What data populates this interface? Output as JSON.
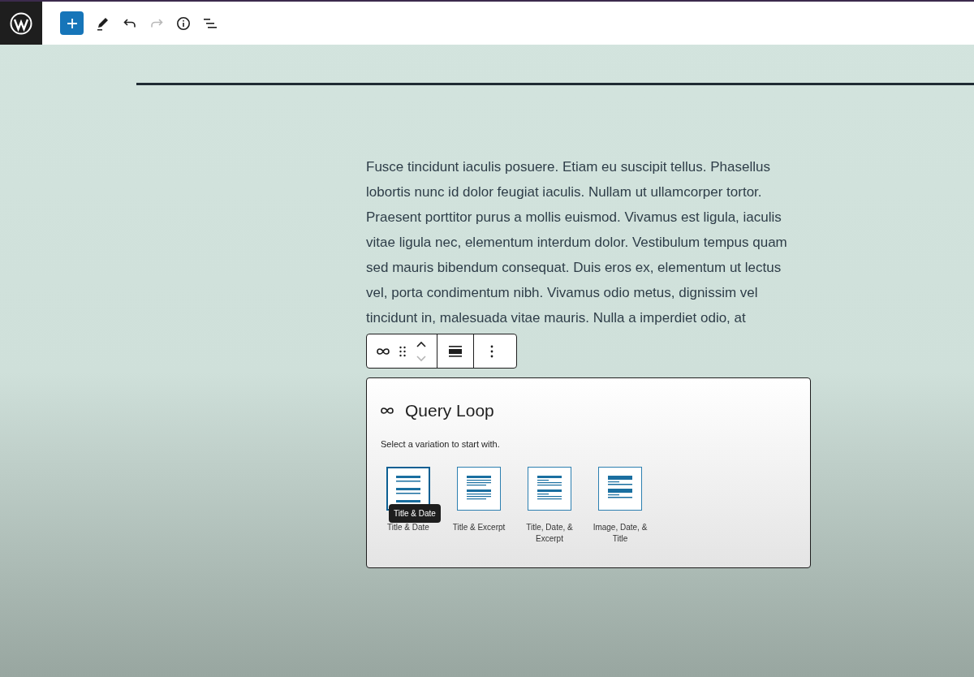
{
  "toolbar": [
    {
      "kind": "add",
      "disabled": false
    },
    {
      "kind": "edit",
      "disabled": false
    },
    {
      "kind": "undo",
      "disabled": false
    },
    {
      "kind": "redo",
      "disabled": true
    },
    {
      "kind": "info",
      "disabled": false
    },
    {
      "kind": "outline",
      "disabled": false
    }
  ],
  "paragraph": "Fusce tincidunt iaculis posuere. Etiam eu suscipit tellus. Phasellus lobortis nunc id dolor feugiat iaculis. Nullam ut ullamcorper tortor. Praesent porttitor purus a mollis euismod. Vivamus est ligula, iaculis vitae ligula nec, elementum interdum dolor. Vestibulum tempus quam sed mauris bibendum consequat. Duis eros ex, elementum ut lectus vel, porta condimentum nibh. Vivamus odio metus, dignissim vel tincidunt in, malesuada vitae mauris. Nulla a imperdiet odio, at",
  "placeholder": {
    "title": "Query Loop",
    "instructions": "Select a variation to start with.",
    "variations": [
      {
        "kind": "title-date",
        "label": "Title & Date",
        "hovered": true
      },
      {
        "kind": "title-excerpt",
        "label": "Title & Excerpt",
        "hovered": false
      },
      {
        "kind": "title-date-excerpt",
        "label": "Title, Date, & Excerpt",
        "hovered": false
      },
      {
        "kind": "image-date-title",
        "label": "Image, Date, & Title",
        "hovered": false
      }
    ],
    "tooltip": "Title & Date"
  }
}
